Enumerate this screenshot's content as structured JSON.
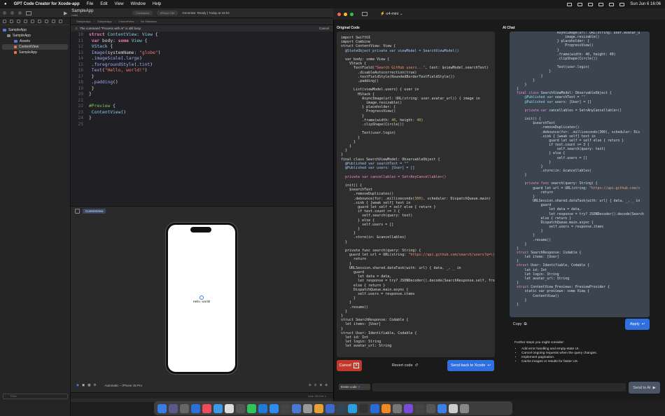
{
  "menubar": {
    "app": "GPT Code Creator for Xcode-app",
    "items": [
      "File",
      "Edit",
      "View",
      "Window",
      "Help"
    ],
    "clock": "Sun Jun 6  16:06"
  },
  "xcode": {
    "project": "SampleApp",
    "branch": "main",
    "tab1": "Contractor",
    "tab2": "iPhone 15e",
    "status": "Generate: Ready | Today at 16:04",
    "jump": [
      "SampleApp",
      "SampleApp",
      "ContentView",
      "No Selection"
    ],
    "notice": "The command \"Process with AI\" is still busy.",
    "notice_cancel": "Cancel",
    "tree": [
      {
        "label": "SampleApp"
      },
      {
        "label": "SampleApp"
      },
      {
        "label": "Assets"
      },
      {
        "label": "ContentView"
      },
      {
        "label": "SampleApp"
      }
    ],
    "filter_placeholder": "Filter",
    "preview_pill": "ContentView",
    "preview_text": "Hello, world!",
    "device": "Automatic – iPhone 15 Pro",
    "cursor": "Line: 25  Col: 1"
  },
  "gpt": {
    "model": "o4-mini",
    "original_label": "Original Code",
    "chat_label": "AI Chat",
    "cancel": "Cancel",
    "revert": "Revert code",
    "send_back": "Send back to Xcode",
    "copy": "Copy",
    "apply": "Apply",
    "steps_title": "Further steps you might consider:",
    "steps": [
      "Add error handling and empty-state UI.",
      "Cancel ongoing requests when the query changes.",
      "Implement pagination.",
      "Cache images or results for faster UX."
    ],
    "scope": "Entire code",
    "send_ai": "Send to AI"
  },
  "colors": {
    "accent": "#2f6fe0",
    "danger": "#c0392b",
    "chat_bg": "#3a4550"
  }
}
